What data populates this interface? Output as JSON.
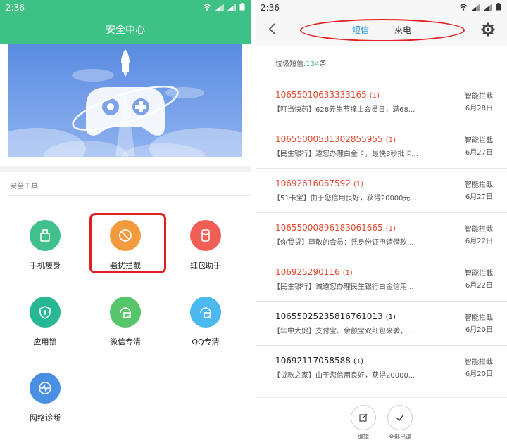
{
  "left": {
    "status_time": "2:36",
    "title": "安全中心",
    "tools_label": "安全工具",
    "tools": [
      {
        "label": "手机瘦身",
        "color": "#3fc08c",
        "icon": "broom-icon"
      },
      {
        "label": "骚扰拦截",
        "color": "#f29a3d",
        "icon": "block-icon"
      },
      {
        "label": "红包助手",
        "color": "#ef5f55",
        "icon": "red-packet-icon"
      },
      {
        "label": "应用锁",
        "color": "#25b892",
        "icon": "shield-lock-icon"
      },
      {
        "label": "微信专清",
        "color": "#57c56a",
        "icon": "wechat-clean-icon"
      },
      {
        "label": "QQ专清",
        "color": "#4bb8f0",
        "icon": "qq-clean-icon"
      },
      {
        "label": "网络诊断",
        "color": "#4a90e2",
        "icon": "network-diagnosis-icon"
      }
    ]
  },
  "right": {
    "status_time": "2:36",
    "tabs": {
      "sms": "短信",
      "calls": "来电"
    },
    "spam_prefix": "垃圾短信:",
    "spam_count": "134",
    "spam_suffix": "条",
    "messages": [
      {
        "number": "10655010633333165",
        "count": "(1)",
        "preview": "【叮当快药】628养生节撞上会员日，满68...",
        "tag": "智能拦截",
        "date": "6月28日",
        "red": true
      },
      {
        "number": "10655000531302855955",
        "count": "(1)",
        "preview": "【民生银行】邀您办理白金卡，最快3秒批卡...",
        "tag": "智能拦截",
        "date": "6月27日",
        "red": true
      },
      {
        "number": "10692616067592",
        "count": "(1)",
        "preview": "【51卡宝】由于您信用良好，获得20000元...",
        "tag": "智能拦截",
        "date": "6月27日",
        "red": true
      },
      {
        "number": "10655000896183061665",
        "count": "(1)",
        "preview": "【你我贷】尊敬的会员：凭身份证申请借款...",
        "tag": "智能拦截",
        "date": "6月22日",
        "red": true
      },
      {
        "number": "106925290116",
        "count": "(1)",
        "preview": "【民生银行】诚邀您办理民生银行白金信用...",
        "tag": "智能拦截",
        "date": "6月22日",
        "red": true
      },
      {
        "number": "10655025235816761013",
        "count": "(1)",
        "preview": "【年中大促】支付宝、余额宝双红包来袭，...",
        "tag": "智能拦截",
        "date": "6月20日",
        "red": false
      },
      {
        "number": "10692117058588",
        "count": "(1)",
        "preview": "【贷款之家】由于您信用良好，获得20000...",
        "tag": "智能拦截",
        "date": "6月20日",
        "red": false
      }
    ],
    "bottom": {
      "edit": "编辑",
      "mark_all_read": "全部已读"
    }
  }
}
